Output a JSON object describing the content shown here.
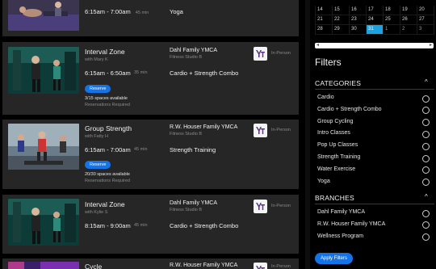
{
  "classes": [
    {
      "name": "",
      "instructor": "",
      "time": "6:15am - 7:00am",
      "duration": "45 min",
      "location": "",
      "room": "",
      "type": "Yoga",
      "mode": "",
      "reserve_label": "",
      "spaces": "",
      "reservations_note": ""
    },
    {
      "name": "Interval Zone",
      "instructor": "with Mary K",
      "time": "6:15am - 6:50am",
      "duration": "35 min",
      "location": "Dahl Family YMCA",
      "room": "Fitness Studio B",
      "type": "Cardio + Strength Combo",
      "mode": "In-Person",
      "reserve_label": "Reserve",
      "spaces": "3/15 spaces available",
      "reservations_note": "Reservations Required"
    },
    {
      "name": "Group Strength",
      "instructor": "with Fatty H",
      "time": "6:15am - 7:00am",
      "duration": "45 min",
      "location": "R.W. Houser Family YMCA",
      "room": "Fitness Studio B",
      "type": "Strength Training",
      "mode": "In-Person",
      "reserve_label": "Reserve",
      "spaces": "20/30 spaces available",
      "reservations_note": "Reservations Required"
    },
    {
      "name": "Interval Zone",
      "instructor": "with Kylie S",
      "time": "8:15am - 9:00am",
      "duration": "45 min",
      "location": "Dahl Family YMCA",
      "room": "Fitness Studio B",
      "type": "Cardio + Strength Combo",
      "mode": "In-Person",
      "reserve_label": "",
      "spaces": "",
      "reservations_note": ""
    },
    {
      "name": "Cycle",
      "instructor": "",
      "time": "",
      "duration": "",
      "location": "R.W. Houser Family YMCA",
      "room": "",
      "type": "",
      "mode": "In-Person",
      "reserve_label": "",
      "spaces": "",
      "reservations_note": ""
    }
  ],
  "calendar": {
    "rows": [
      [
        {
          "d": "14"
        },
        {
          "d": "15"
        },
        {
          "d": "16"
        },
        {
          "d": "17"
        },
        {
          "d": "18"
        },
        {
          "d": "19"
        },
        {
          "d": "20"
        }
      ],
      [
        {
          "d": "21"
        },
        {
          "d": "22"
        },
        {
          "d": "23"
        },
        {
          "d": "24"
        },
        {
          "d": "25"
        },
        {
          "d": "26"
        },
        {
          "d": "27"
        }
      ],
      [
        {
          "d": "28"
        },
        {
          "d": "29"
        },
        {
          "d": "30"
        },
        {
          "d": "31",
          "selected": true
        },
        {
          "d": "1",
          "other": true
        },
        {
          "d": "2",
          "other": true
        },
        {
          "d": "3",
          "other": true
        }
      ]
    ],
    "prev_arrow": "◂",
    "next_arrow": "▸",
    "selected_color": "#1aa3e0"
  },
  "filters": {
    "title": "Filters",
    "categories": {
      "title": "CATEGORIES",
      "collapse_icon": "^",
      "options": [
        "Cardio",
        "Cardio + Strength Combo",
        "Group Cycling",
        "Intro Classes",
        "Pop Up Classes",
        "Strength Training",
        "Water Exercise",
        "Yoga"
      ]
    },
    "branches": {
      "title": "BRANCHES",
      "collapse_icon": "^",
      "options": [
        "Dahl Family YMCA",
        "R.W. Houser Family YMCA",
        "Wellness Program"
      ]
    },
    "apply_label": "Apply Filters"
  },
  "colors": {
    "accent": "#1473e6",
    "card_bg": "#262626",
    "ymca_logo": "#5a2b86"
  }
}
